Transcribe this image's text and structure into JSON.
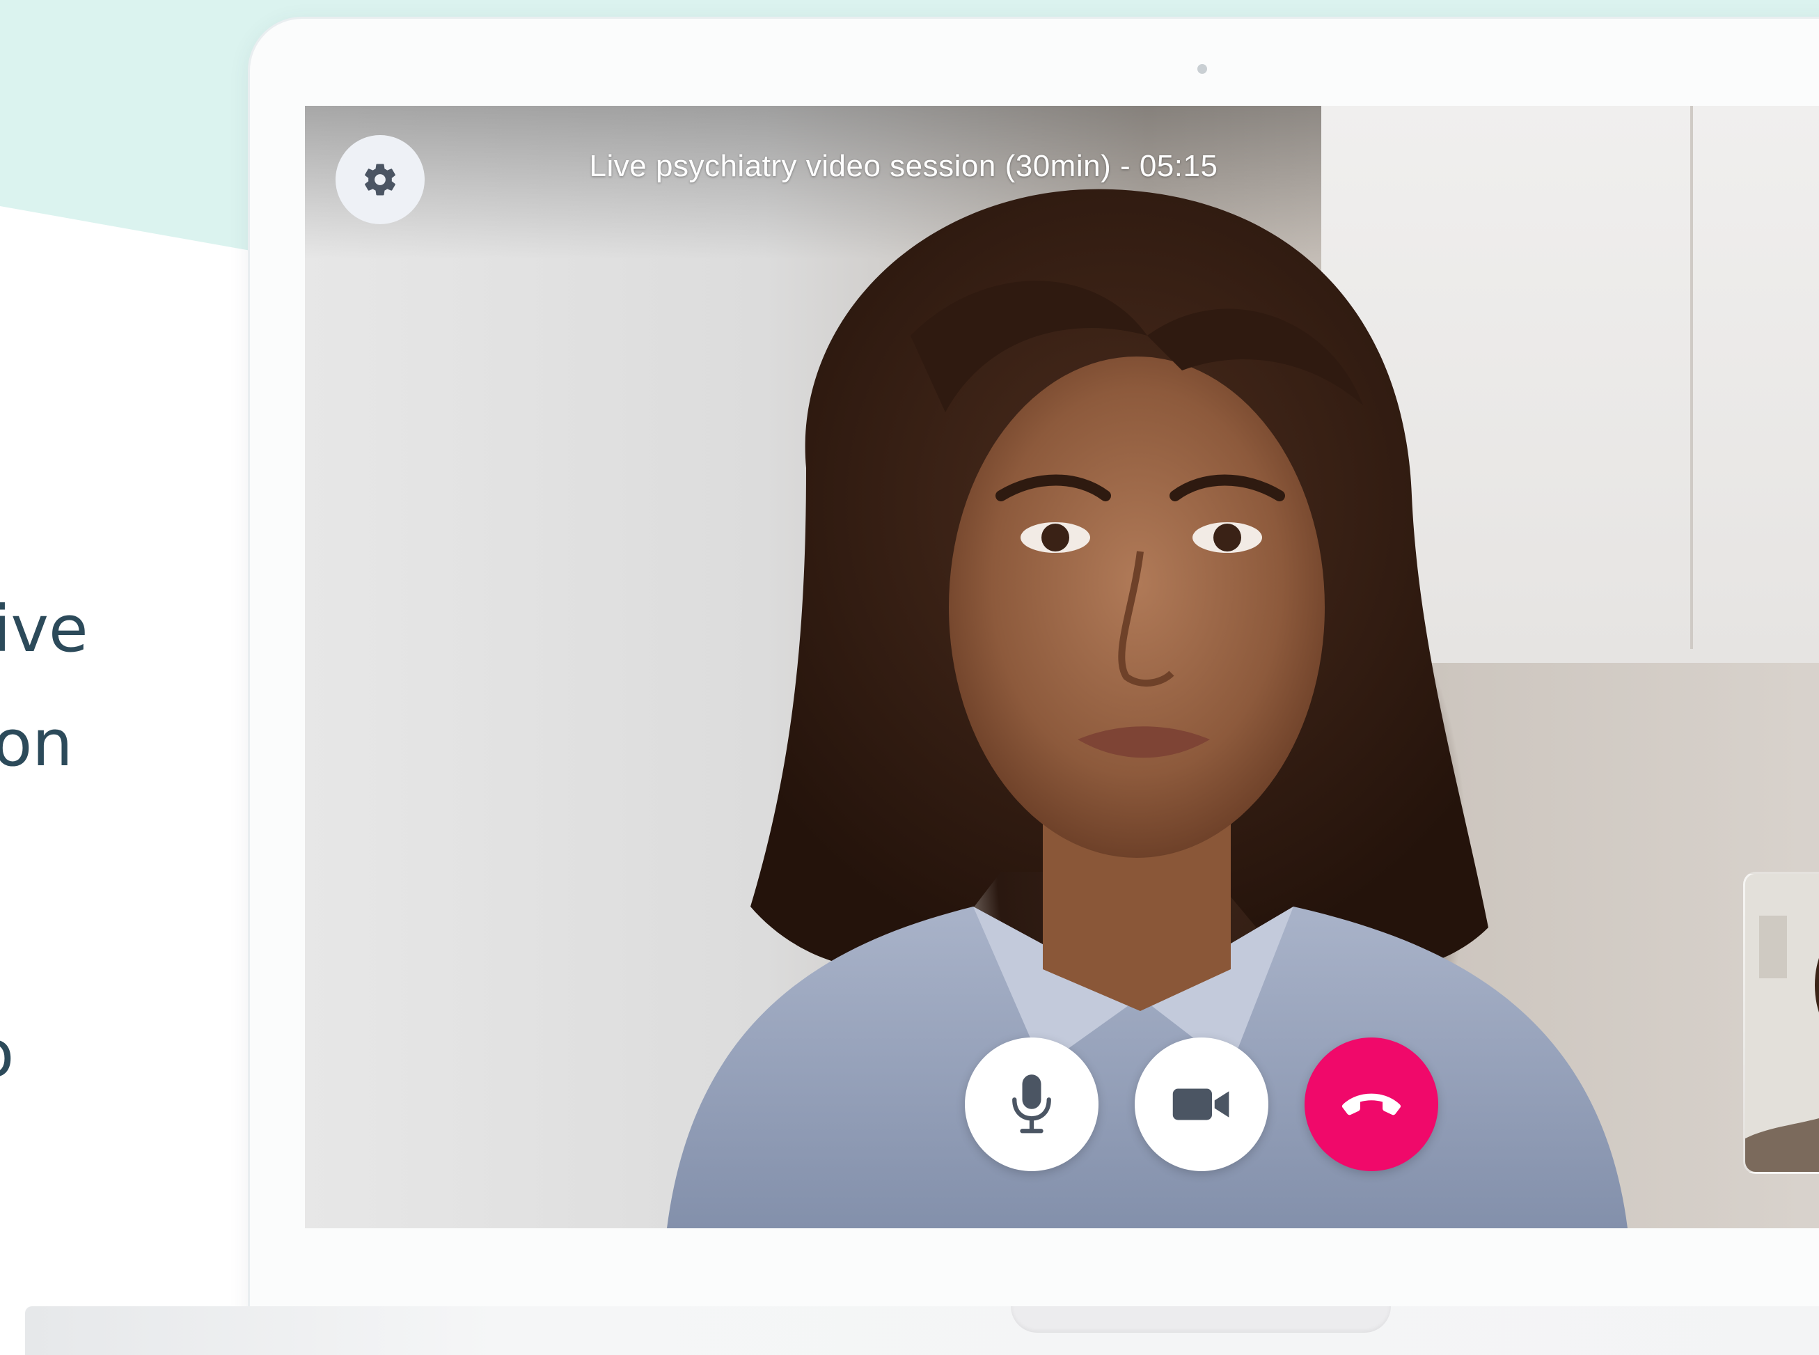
{
  "side_text": [
    "ive",
    "on",
    "o"
  ],
  "session": {
    "title": "Live psychiatry video session (30min) - 05:15"
  },
  "controls": {
    "settings_icon": "gear-icon",
    "mic_icon": "microphone-icon",
    "camera_icon": "video-camera-icon",
    "end_call_icon": "phone-hangup-icon"
  },
  "colors": {
    "teal_background": "#dbf3ef",
    "side_text": "#2c4a5a",
    "end_call": "#f0096a",
    "control_button": "#ffffff",
    "settings_button": "#eef1f6"
  }
}
